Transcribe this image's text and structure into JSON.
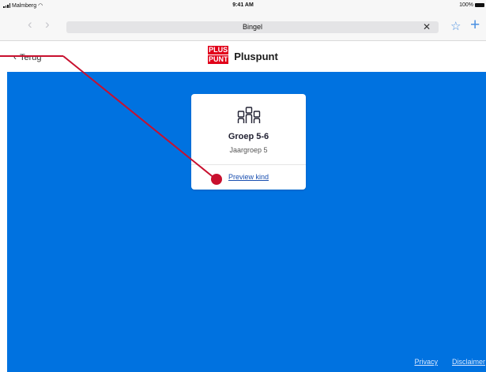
{
  "status_bar": {
    "carrier": "Malmberg",
    "time": "9:41 AM",
    "battery": "100%"
  },
  "browser": {
    "back_icon": "chevron-left-icon",
    "forward_icon": "chevron-right-icon",
    "address": "Bingel",
    "clear_icon": "close-icon",
    "bookmark_icon": "star-icon",
    "add_tab_icon": "plus-icon"
  },
  "header": {
    "back_label": "Terug",
    "logo_top": "PLUS",
    "logo_bottom": "PUNT",
    "brand_name": "Pluspunt"
  },
  "card": {
    "icon": "group-icon",
    "title": "Groep 5-6",
    "subtitle": "Jaargroep 5",
    "link": "Preview kind"
  },
  "footer": {
    "privacy": "Privacy",
    "disclaimer": "Disclaimer"
  },
  "colors": {
    "background_blue": "#0072e0",
    "logo_red": "#e1001a",
    "annotation_red": "#c8102e"
  }
}
